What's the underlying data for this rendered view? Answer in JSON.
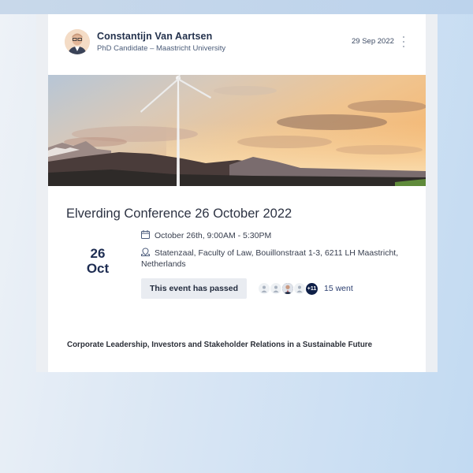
{
  "post": {
    "author_name": "Constantijn Van Aartsen",
    "author_role": "PhD Candidate – Maastricht University",
    "date": "29 Sep 2022"
  },
  "event": {
    "title": "Elverding Conference 26 October 2022",
    "day": "26",
    "month": "Oct",
    "time": "October 26th, 9:00AM - 5:30PM",
    "location": "Statenzaal, Faculty of Law, Bouillonstraat 1-3, 6211 LH Maastricht, Netherlands",
    "status_label": "This event has passed",
    "extra_attendees": "+11",
    "went_label": "15 went",
    "subtitle": "Corporate Leadership, Investors and Stakeholder Relations in a Sustainable Future"
  },
  "icons": {
    "more": "more-vertical-icon",
    "calendar": "calendar-icon",
    "location": "location-pin-icon",
    "attendee": "user-icon"
  },
  "colors": {
    "name": "#24324d",
    "date_text": "#1e2d52",
    "badge_bg": "#e9ecf1",
    "more_badge": "#0e1f47",
    "went": "#2c3f70"
  }
}
